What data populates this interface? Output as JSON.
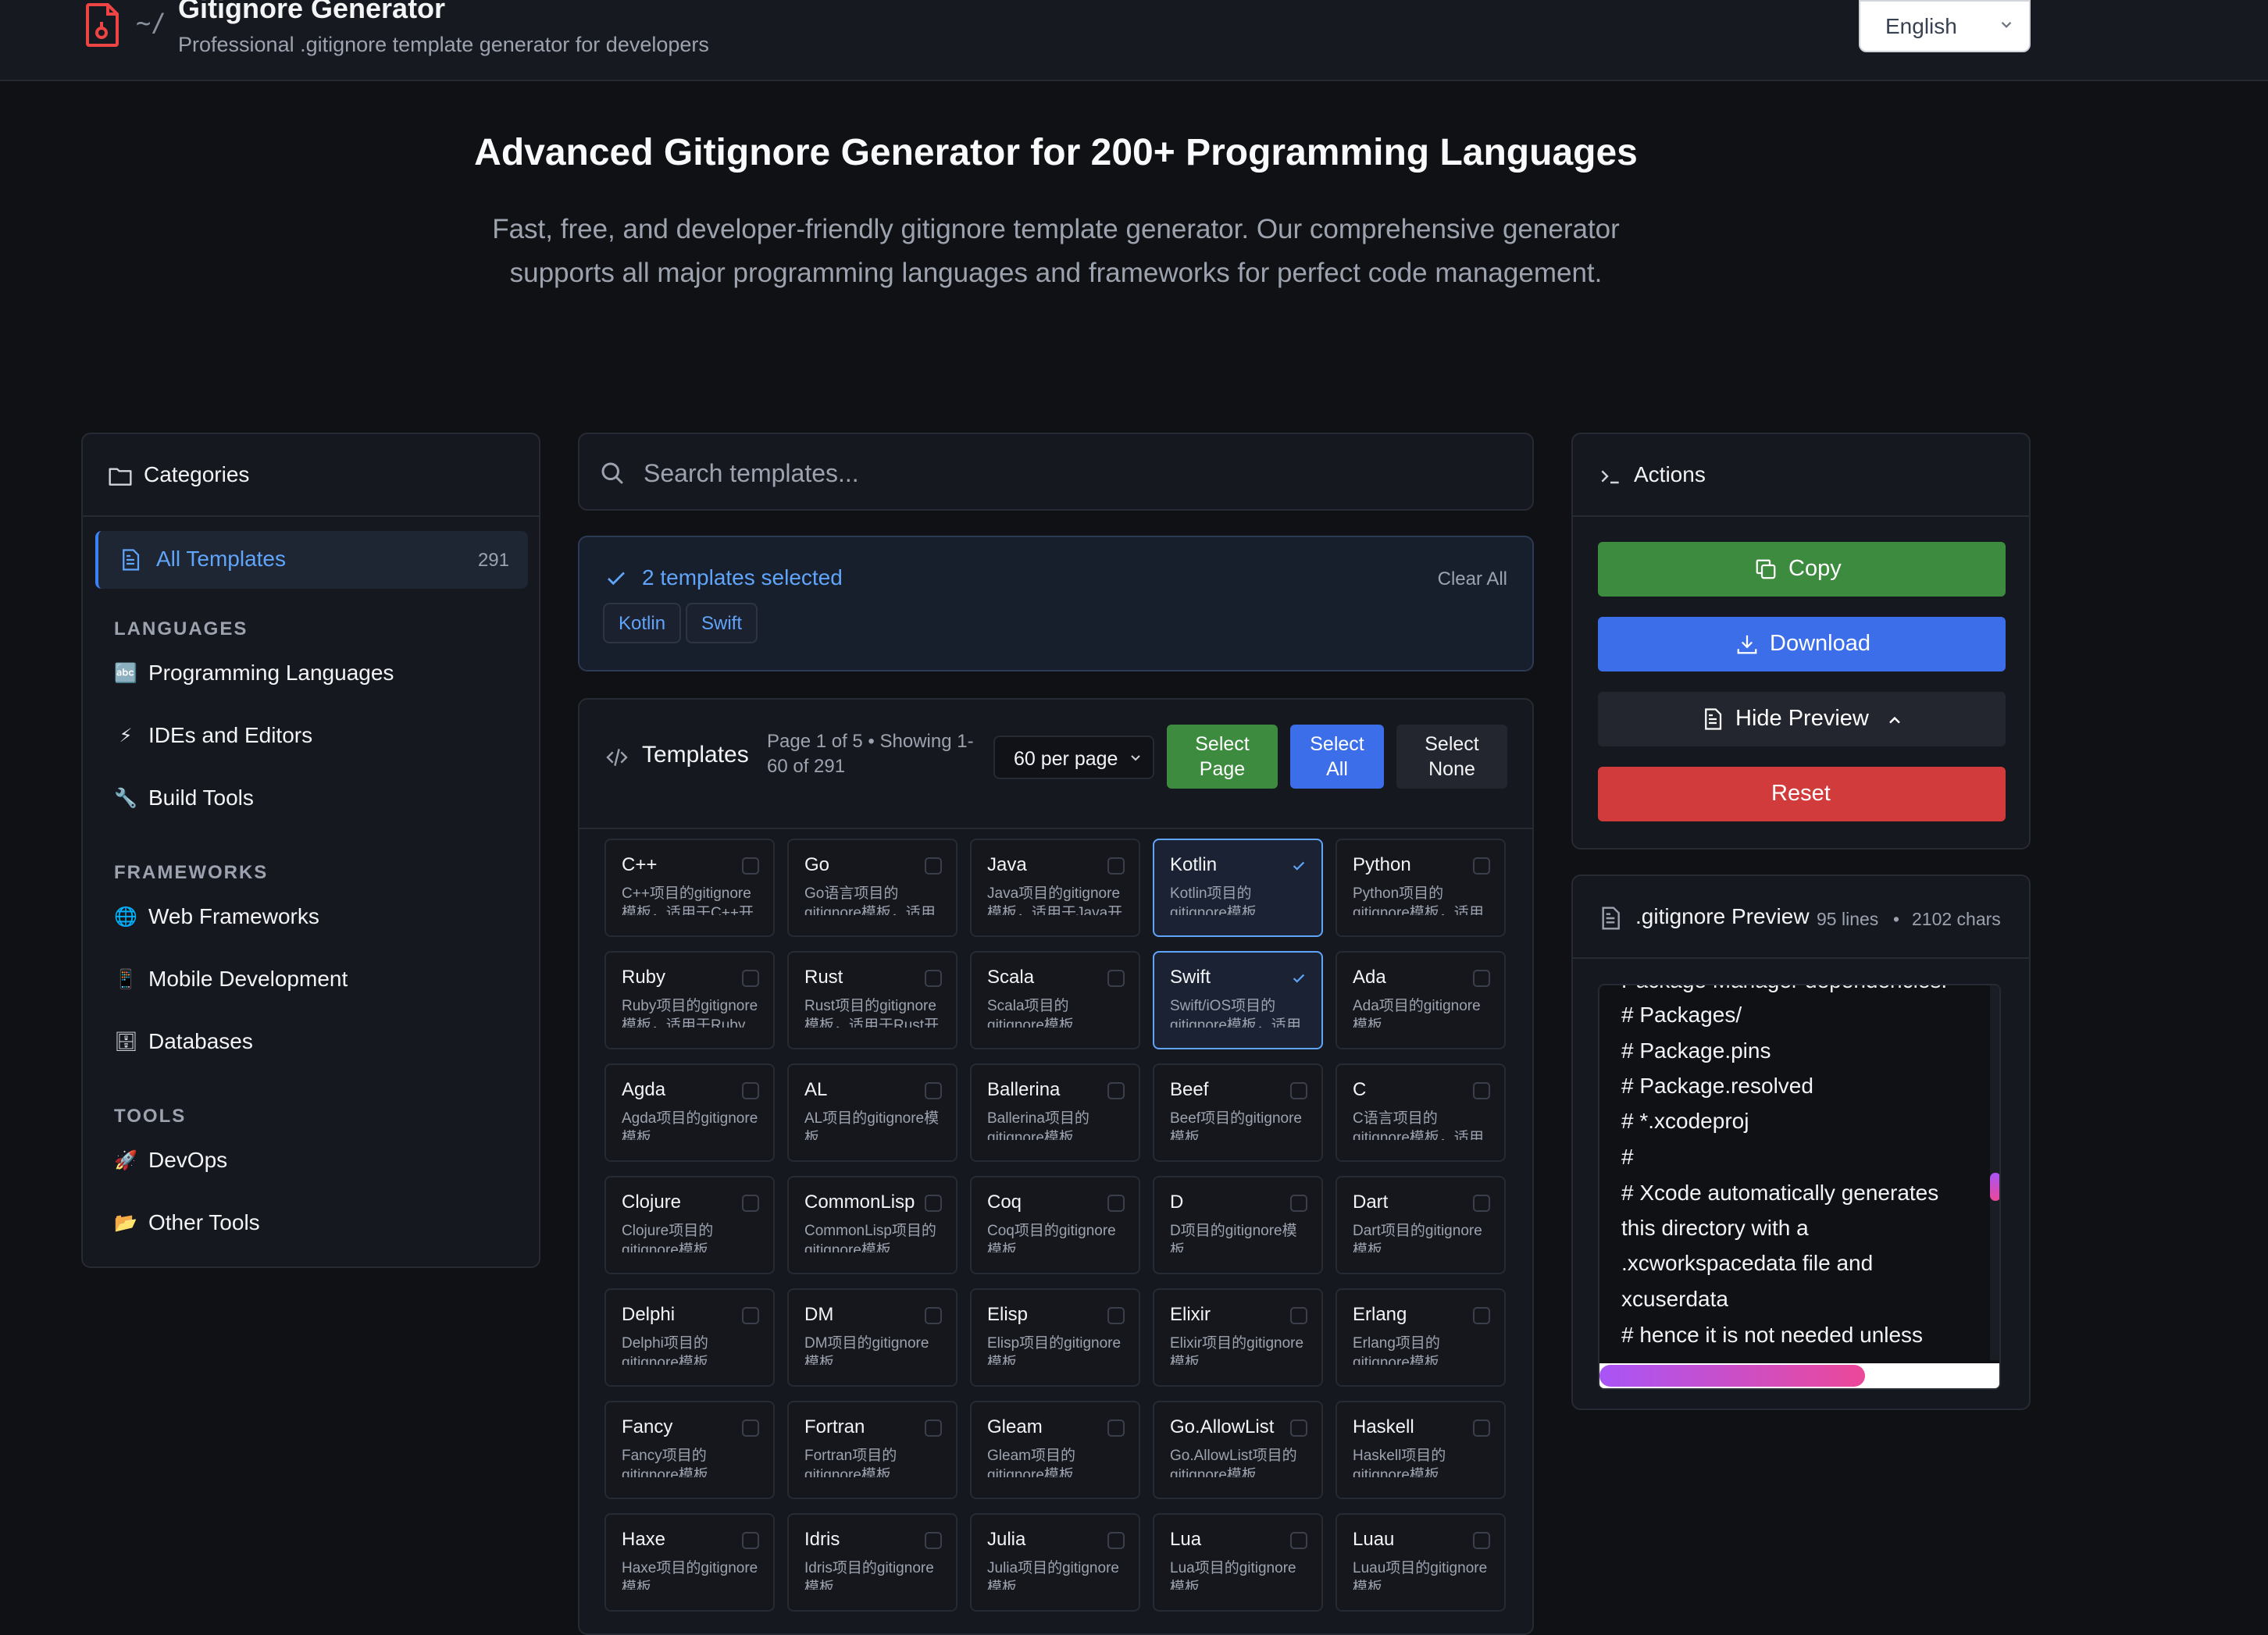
{
  "header": {
    "prompt_symbol": "~/",
    "title": "Gitignore Generator",
    "subtitle": "Professional .gitignore template generator for developers",
    "language": "English"
  },
  "hero": {
    "title": "Advanced Gitignore Generator for 200+ Programming Languages",
    "description": "Fast, free, and developer-friendly gitignore template generator. Our comprehensive generator supports all major programming languages and frameworks for perfect code management."
  },
  "categories": {
    "title": "Categories",
    "all": {
      "label": "All Templates",
      "count": "291"
    },
    "groups": [
      {
        "name": "LANGUAGES",
        "items": [
          {
            "icon": "🔤",
            "label": "Programming Languages"
          },
          {
            "icon": "⚡",
            "label": "IDEs and Editors"
          },
          {
            "icon": "🔧",
            "label": "Build Tools"
          }
        ]
      },
      {
        "name": "FRAMEWORKS",
        "items": [
          {
            "icon": "🌐",
            "label": "Web Frameworks"
          },
          {
            "icon": "📱",
            "label": "Mobile Development"
          },
          {
            "icon": "🗄",
            "label": "Databases"
          }
        ]
      },
      {
        "name": "TOOLS",
        "items": [
          {
            "icon": "🚀",
            "label": "DevOps"
          },
          {
            "icon": "📂",
            "label": "Other Tools"
          }
        ]
      }
    ]
  },
  "search": {
    "placeholder": "Search templates..."
  },
  "selection": {
    "summary": "2 templates selected",
    "clear_label": "Clear All",
    "tags": [
      "Kotlin",
      "Swift"
    ]
  },
  "templates": {
    "title": "Templates",
    "page_info": "Page 1 of 5 • Showing 1-60 of 291",
    "per_page": "60 per page",
    "select_page": "Select Page",
    "select_all": "Select All",
    "select_none": "Select None",
    "items": [
      {
        "name": "C++",
        "desc": "C++项目的gitignore模板，适用于C++开发",
        "selected": false
      },
      {
        "name": "Go",
        "desc": "Go语言项目的gitignore模板，适用于Go开发",
        "selected": false
      },
      {
        "name": "Java",
        "desc": "Java项目的gitignore模板，适用于Java开发",
        "selected": false
      },
      {
        "name": "Kotlin",
        "desc": "Kotlin项目的gitignore模板",
        "selected": true
      },
      {
        "name": "Python",
        "desc": "Python项目的gitignore模板，适用于Python开发",
        "selected": false
      },
      {
        "name": "Ruby",
        "desc": "Ruby项目的gitignore模板，适用于Ruby开发",
        "selected": false
      },
      {
        "name": "Rust",
        "desc": "Rust项目的gitignore模板，适用于Rust开发",
        "selected": false
      },
      {
        "name": "Scala",
        "desc": "Scala项目的gitignore模板",
        "selected": false
      },
      {
        "name": "Swift",
        "desc": "Swift/iOS项目的gitignore模板，适用于iOS开发",
        "selected": true
      },
      {
        "name": "Ada",
        "desc": "Ada项目的gitignore模板",
        "selected": false
      },
      {
        "name": "Agda",
        "desc": "Agda项目的gitignore模板",
        "selected": false
      },
      {
        "name": "AL",
        "desc": "AL项目的gitignore模板",
        "selected": false
      },
      {
        "name": "Ballerina",
        "desc": "Ballerina项目的gitignore模板",
        "selected": false
      },
      {
        "name": "Beef",
        "desc": "Beef项目的gitignore模板",
        "selected": false
      },
      {
        "name": "C",
        "desc": "C语言项目的gitignore模板，适用于C开发",
        "selected": false
      },
      {
        "name": "Clojure",
        "desc": "Clojure项目的gitignore模板",
        "selected": false
      },
      {
        "name": "CommonLisp",
        "desc": "CommonLisp项目的gitignore模板",
        "selected": false
      },
      {
        "name": "Coq",
        "desc": "Coq项目的gitignore模板",
        "selected": false
      },
      {
        "name": "D",
        "desc": "D项目的gitignore模板",
        "selected": false
      },
      {
        "name": "Dart",
        "desc": "Dart项目的gitignore模板",
        "selected": false
      },
      {
        "name": "Delphi",
        "desc": "Delphi项目的gitignore模板",
        "selected": false
      },
      {
        "name": "DM",
        "desc": "DM项目的gitignore模板",
        "selected": false
      },
      {
        "name": "Elisp",
        "desc": "Elisp项目的gitignore模板",
        "selected": false
      },
      {
        "name": "Elixir",
        "desc": "Elixir项目的gitignore模板",
        "selected": false
      },
      {
        "name": "Erlang",
        "desc": "Erlang项目的gitignore模板",
        "selected": false
      },
      {
        "name": "Fancy",
        "desc": "Fancy项目的gitignore模板",
        "selected": false
      },
      {
        "name": "Fortran",
        "desc": "Fortran项目的gitignore模板",
        "selected": false
      },
      {
        "name": "Gleam",
        "desc": "Gleam项目的gitignore模板",
        "selected": false
      },
      {
        "name": "Go.AllowList",
        "desc": "Go.AllowList项目的gitignore模板",
        "selected": false
      },
      {
        "name": "Haskell",
        "desc": "Haskell项目的gitignore模板",
        "selected": false
      },
      {
        "name": "Haxe",
        "desc": "Haxe项目的gitignore模板",
        "selected": false
      },
      {
        "name": "Idris",
        "desc": "Idris项目的gitignore模板",
        "selected": false
      },
      {
        "name": "Julia",
        "desc": "Julia项目的gitignore模板",
        "selected": false
      },
      {
        "name": "Lua",
        "desc": "Lua项目的gitignore模板",
        "selected": false
      },
      {
        "name": "Luau",
        "desc": "Luau项目的gitignore模板",
        "selected": false
      }
    ]
  },
  "actions": {
    "title": "Actions",
    "copy": "Copy",
    "download": "Download",
    "hide_preview": "Hide Preview",
    "reset": "Reset",
    "colors": {
      "copy": "#3d8b3f",
      "download": "#3b6ee8",
      "reset": "#d13b3b"
    }
  },
  "preview": {
    "title": ".gitignore Preview",
    "lines": "95 lines",
    "chars": "2102 chars",
    "code": [
      "Package Manager dependencies.",
      "# Packages/",
      "# Package.pins",
      "# Package.resolved",
      "# *.xcodeproj",
      "#",
      "# Xcode automatically generates",
      "this directory with a",
      ".xcworkspacedata file and",
      "xcuserdata",
      "# hence it is not needed unless"
    ]
  }
}
